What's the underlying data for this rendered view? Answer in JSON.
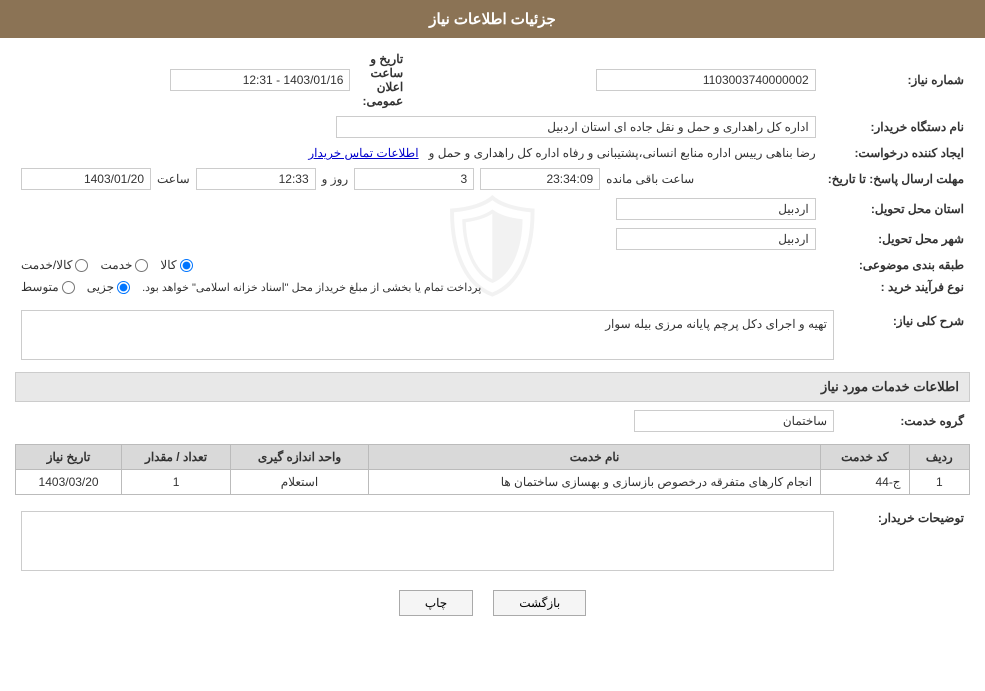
{
  "page": {
    "title": "جزئیات اطلاعات نیاز",
    "header": {
      "bg_color": "#8B7355",
      "text_color": "#ffffff"
    }
  },
  "fields": {
    "need_number_label": "شماره نیاز:",
    "need_number_value": "1103003740000002",
    "buyer_org_label": "نام دستگاه خریدار:",
    "buyer_org_value": "اداره کل راهداری و حمل و نقل جاده ای استان اردبیل",
    "creator_label": "ایجاد کننده درخواست:",
    "creator_value": "رضا بناهی رییس اداره منابع انسانی،پشتیبانی و رفاه اداره کل راهداری و حمل و",
    "creator_link": "اطلاعات تماس خریدار",
    "deadline_label": "مهلت ارسال پاسخ: تا تاریخ:",
    "deadline_date": "1403/01/20",
    "deadline_time_label": "ساعت",
    "deadline_time": "12:33",
    "deadline_day_label": "روز و",
    "deadline_days": "3",
    "deadline_remaining_label": "ساعت باقی مانده",
    "deadline_remaining": "23:34:09",
    "delivery_province_label": "استان محل تحویل:",
    "delivery_province_value": "اردبیل",
    "delivery_city_label": "شهر محل تحویل:",
    "delivery_city_value": "اردبیل",
    "category_label": "طبقه بندی موضوعی:",
    "category_goods": "کالا",
    "category_service": "خدمت",
    "category_goods_service": "کالا/خدمت",
    "purchase_type_label": "نوع فرآیند خرید :",
    "purchase_type_partial": "جزیی",
    "purchase_type_medium": "متوسط",
    "purchase_type_note": "پرداخت تمام یا بخشی از مبلغ خریداز محل \"اسناد خزانه اسلامی\" خواهد بود.",
    "announce_label": "تاریخ و ساعت اعلان عمومی:",
    "announce_value": "1403/01/16 - 12:31",
    "need_desc_label": "شرح کلی نیاز:",
    "need_desc_value": "تهیه و اجرای دکل پرچم پایانه مرزی بیله سوار",
    "services_section_label": "اطلاعات خدمات مورد نیاز",
    "service_group_label": "گروه خدمت:",
    "service_group_value": "ساختمان",
    "table": {
      "col_row": "ردیف",
      "col_code": "کد خدمت",
      "col_name": "نام خدمت",
      "col_unit": "واحد اندازه گیری",
      "col_qty": "تعداد / مقدار",
      "col_date": "تاریخ نیاز",
      "rows": [
        {
          "row": "1",
          "code": "ج-44",
          "name": "انجام کارهای متفرقه درخصوص بازسازی و بهسازی ساختمان ها",
          "unit": "استعلام",
          "qty": "1",
          "date": "1403/03/20"
        }
      ]
    },
    "buyer_notes_label": "توضیحات خریدار:",
    "buyer_notes_value": "",
    "btn_print": "چاپ",
    "btn_back": "بازگشت"
  }
}
